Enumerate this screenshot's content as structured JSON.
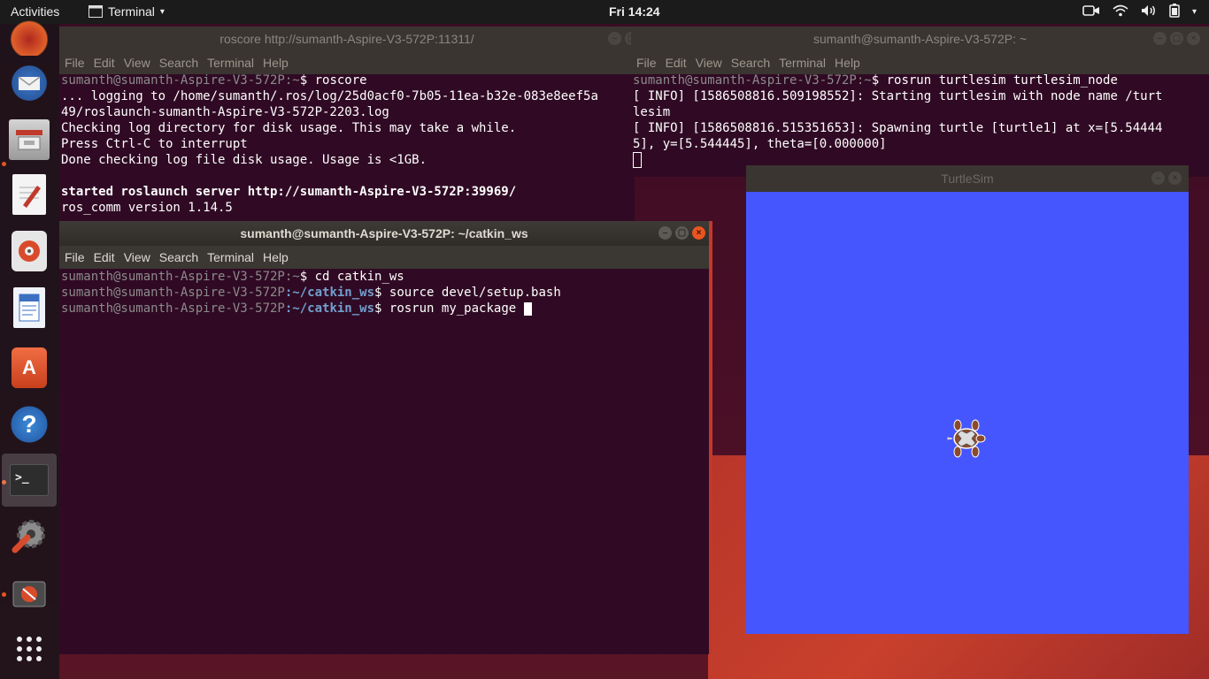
{
  "topbar": {
    "activities": "Activities",
    "app_name": "Terminal",
    "clock": "Fri 14:24",
    "tray_icons": [
      "camera-icon",
      "wifi-icon",
      "volume-icon",
      "battery-icon",
      "chevron-down-icon"
    ]
  },
  "dock": {
    "items": [
      "firefox-icon",
      "thunderbird-icon",
      "files-icon",
      "text-editor-icon",
      "rhythmbox-icon",
      "libreoffice-writer-icon",
      "software-center-icon",
      "help-icon",
      "terminal-icon",
      "settings-icon",
      "disk-usage-icon",
      "show-applications-icon"
    ]
  },
  "menu": [
    "File",
    "Edit",
    "View",
    "Search",
    "Terminal",
    "Help"
  ],
  "term_roscore": {
    "title": "roscore http://sumanth-Aspire-V3-572P:11311/",
    "prompt_user": "sumanth@sumanth-Aspire-V3-572P",
    "prompt_path": ":~",
    "command": "$ roscore",
    "line1": "... logging to /home/sumanth/.ros/log/25d0acf0-7b05-11ea-b32e-083e8eef5a",
    "line2": "49/roslaunch-sumanth-Aspire-V3-572P-2203.log",
    "line3": "Checking log directory for disk usage. This may take a while.",
    "line4": "Press Ctrl-C to interrupt",
    "line5": "Done checking log file disk usage. Usage is <1GB.",
    "line6": "started roslaunch server http://sumanth-Aspire-V3-572P:39969/",
    "line7": "ros_comm version 1.14.5"
  },
  "term_turtlesim": {
    "title": "sumanth@sumanth-Aspire-V3-572P: ~",
    "prompt_user": "sumanth@sumanth-Aspire-V3-572P",
    "prompt_path": ":~",
    "command": "$ rosrun turtlesim turtlesim_node",
    "line1": "[ INFO] [1586508816.509198552]: Starting turtlesim with node name /turt",
    "line2": "lesim",
    "line3": "[ INFO] [1586508816.515351653]: Spawning turtle [turtle1] at x=[5.54444",
    "line4": "5], y=[5.544445], theta=[0.000000]"
  },
  "term_catkin": {
    "title": "sumanth@sumanth-Aspire-V3-572P: ~/catkin_ws",
    "prompt_user": "sumanth@sumanth-Aspire-V3-572P",
    "path_home": ":~",
    "path_ws": ":~/catkin_ws",
    "cmd1": "$ cd catkin_ws",
    "cmd2": "$ source devel/setup.bash",
    "cmd3": "$ rosrun my_package "
  },
  "turtlesim_window": {
    "title": "TurtleSim"
  }
}
